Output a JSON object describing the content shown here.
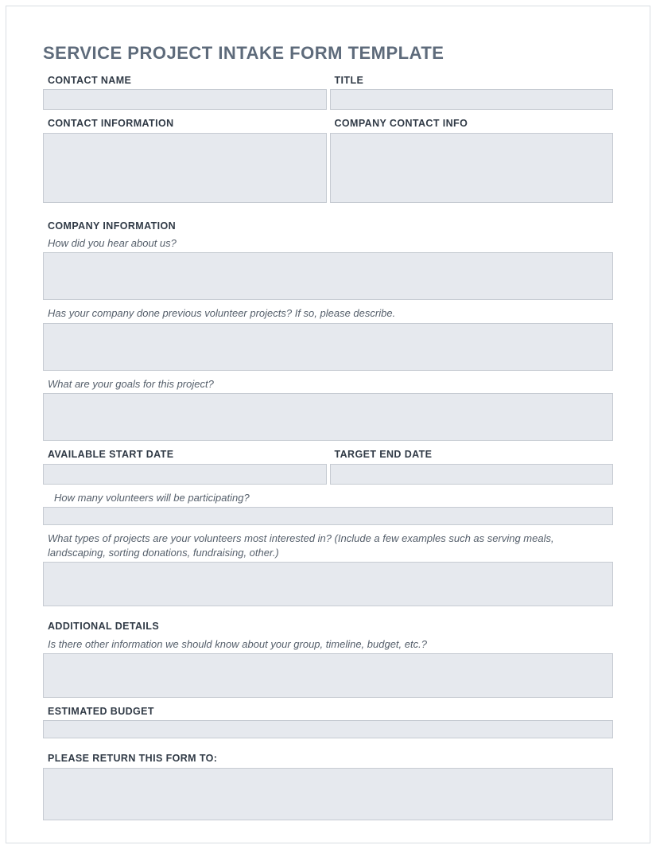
{
  "title": "SERVICE PROJECT INTAKE FORM TEMPLATE",
  "contact_name_label": "CONTACT NAME",
  "title_label": "TITLE",
  "contact_info_label": "CONTACT INFORMATION",
  "company_contact_label": "COMPANY CONTACT INFO",
  "company_info_label": "COMPANY INFORMATION",
  "how_hear_label": "How did you hear about us?",
  "prev_projects_label": "Has your company done previous volunteer projects? If so, please describe.",
  "goals_label": "What are your goals for this project?",
  "start_date_label": "AVAILABLE START DATE",
  "end_date_label": "TARGET END DATE",
  "volunteers_label": "How many volunteers will be participating?",
  "project_types_label": "What types of projects are your volunteers most interested in? (Include a few examples such as serving meals, landscaping, sorting donations, fundraising, other.)",
  "additional_label": "ADDITIONAL DETAILS",
  "additional_sub": "Is there other information we should know about your group, timeline, budget, etc.?",
  "budget_label": "ESTIMATED BUDGET",
  "return_label": "PLEASE RETURN THIS FORM TO:",
  "contact_name_value": "",
  "title_value": "",
  "contact_info_value": "",
  "company_contact_value": "",
  "how_hear_value": "",
  "prev_projects_value": "",
  "goals_value": "",
  "start_date_value": "",
  "end_date_value": "",
  "volunteers_value": "",
  "project_types_value": "",
  "additional_value": "",
  "budget_value": "",
  "return_value": ""
}
